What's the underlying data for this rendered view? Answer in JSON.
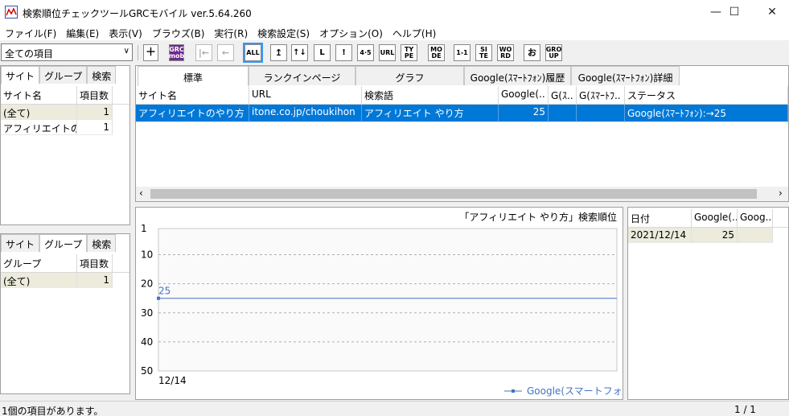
{
  "window": {
    "title": "検索順位チェックツールGRCモバイル  ver.5.64.260",
    "minimize": "—",
    "maximize": "☐",
    "close": "✕"
  },
  "menu": [
    "ファイル(F)",
    "編集(E)",
    "表示(V)",
    "ブラウズ(B)",
    "実行(R)",
    "検索設定(S)",
    "オプション(O)",
    "ヘルプ(H)"
  ],
  "toolbar": {
    "filter_value": "全ての項目",
    "buttons": [
      "＋",
      "GRC mob",
      "|←",
      "←",
      "ALL",
      "↥",
      "↑↓",
      "L",
      "!",
      "4·5",
      "URL",
      "TY PE",
      "MO DE",
      "1-1",
      "SI TE",
      "WO RD",
      "お",
      "GRO UP"
    ]
  },
  "site_panel": {
    "tabs": [
      "サイト",
      "グループ",
      "検索"
    ],
    "headers": [
      "サイト名",
      "項目数"
    ],
    "rows": [
      [
        "(全て)",
        "1"
      ],
      [
        "アフィリエイトのや..",
        "1"
      ]
    ]
  },
  "group_panel": {
    "tabs": [
      "サイト",
      "グループ",
      "検索"
    ],
    "headers": [
      "グループ",
      "項目数"
    ],
    "rows": [
      [
        "(全て)",
        "1"
      ]
    ]
  },
  "main": {
    "tabs": [
      "標準",
      "ランクインページ",
      "グラフ",
      "Google(ｽﾏｰﾄﾌｫﾝ)履歴",
      "Google(ｽﾏｰﾄﾌｫﾝ)詳細"
    ],
    "headers": [
      "サイト名",
      "URL",
      "検索語",
      "Google(..",
      "G(ｽ..",
      "G(ｽﾏｰﾄﾌ..",
      "ステータス"
    ],
    "rows": [
      [
        "アフィリエイトのやり方",
        "itone.co.jp/choukihon",
        "アフィリエイト やり方",
        "25",
        "",
        "",
        "Google(ｽﾏｰﾄﾌｫﾝ):→25"
      ]
    ]
  },
  "chart_data": {
    "type": "line",
    "title": "「アフィリエイト やり方」検索順位",
    "x": [
      "12/14"
    ],
    "series": [
      {
        "name": "Google(スマートフォン)",
        "values": [
          25
        ],
        "color": "#4472c4"
      }
    ],
    "ylim": [
      1,
      50
    ],
    "yticks": [
      "1",
      "10",
      "20",
      "30",
      "40",
      "50"
    ],
    "y_inverted": true,
    "grid": true,
    "legend": "bottom-right",
    "data_label": "25"
  },
  "history": {
    "headers": [
      "日付",
      "Google(..",
      "Goog.."
    ],
    "rows": [
      [
        "2021/12/14",
        "25",
        ""
      ]
    ]
  },
  "status": {
    "message": "1個の項目があります。",
    "page": "1 / 1"
  }
}
